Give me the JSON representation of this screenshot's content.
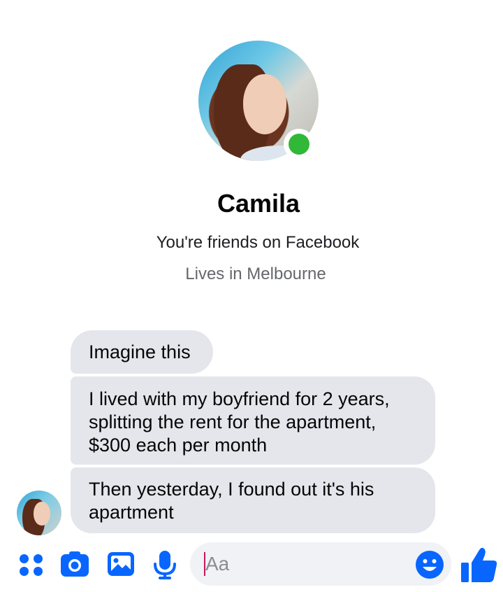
{
  "profile": {
    "name": "Camila",
    "friendship": "You're friends on Facebook",
    "location": "Lives in Melbourne",
    "online": true
  },
  "messages": [
    {
      "text": "Imagine this"
    },
    {
      "text": "I lived with my boyfriend for 2 years, splitting the rent for the apartment, $300 each per month"
    },
    {
      "text": "Then yesterday, I found out it's his apartment"
    }
  ],
  "composer": {
    "placeholder": "Aa",
    "icons": [
      "apps-icon",
      "camera-icon",
      "gallery-icon",
      "microphone-icon",
      "emoji-icon",
      "thumbs-up-icon"
    ]
  },
  "colors": {
    "accent": "#0866ff",
    "online": "#31b838",
    "bubble": "#e4e6eb"
  }
}
